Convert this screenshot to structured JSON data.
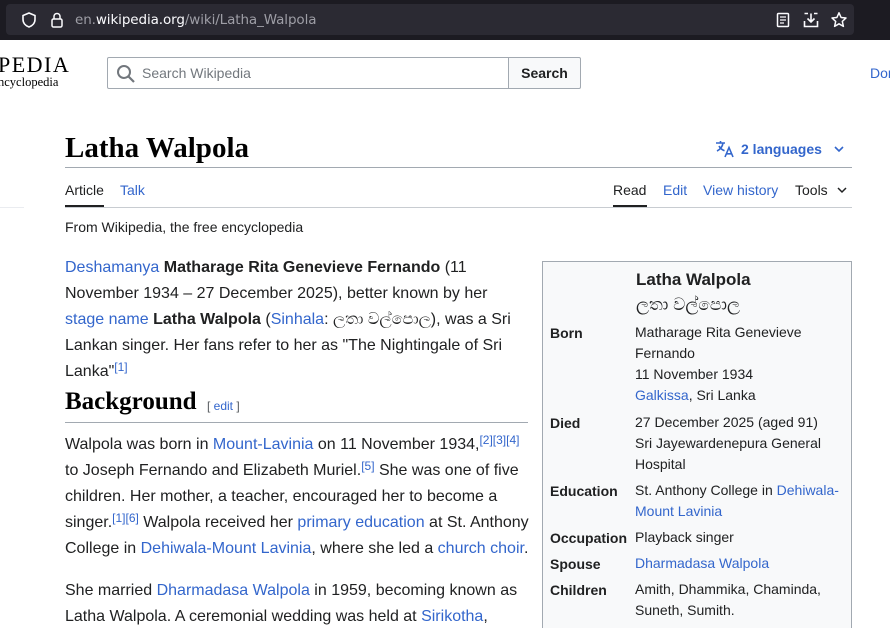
{
  "browser": {
    "url_prefix": "en.",
    "url_domain": "wikipedia.org",
    "url_path": "/wiki/Latha_Walpola",
    "icons": [
      "shield-icon",
      "lock-icon",
      "reader-view-icon",
      "save-to-pocket-icon",
      "bookmark-star-icon"
    ]
  },
  "header": {
    "logo_word": "PEDIA",
    "logo_tagline": "ncyclopedia",
    "search_placeholder": "Search Wikipedia",
    "search_button": "Search",
    "donate_link": "Donate"
  },
  "article": {
    "title": "Latha Walpola",
    "languages_label": "2 languages",
    "tabs_left": [
      "Article",
      "Talk"
    ],
    "tabs_right": [
      "Read",
      "Edit",
      "View history",
      "Tools"
    ],
    "tagline": "From Wikipedia, the free encyclopedia"
  },
  "intro": {
    "l_deshamanya": "Deshamanya",
    "t_name_full": "Matharage Rita Genevieve Fernando",
    "t_dates": " (11 November 1934 – 27 December 2025), better known by her ",
    "l_stage_name": "stage name",
    "t_sp1": " ",
    "t_name_short": "Latha Walpola",
    "t_paren_open": " (",
    "l_sinhala": "Sinhala",
    "t_native": ": ලතා වල්පොල), was a Sri Lankan singer. Her fans refer to her as \"The Nightingale of Sri Lanka\"",
    "r1": "[1]"
  },
  "background": {
    "heading": "Background",
    "edit_open": "[ ",
    "edit_label": "edit",
    "edit_close": " ]",
    "p1": {
      "t1": "Walpola was born in ",
      "l_mount_lavinia": "Mount-Lavinia",
      "t2": " on 11 November 1934,",
      "r1": "[2]",
      "r2": "[3]",
      "r3": "[4]",
      "t3": " to Joseph Fernando and Elizabeth Muriel.",
      "r4": "[5]",
      "t4": " She was one of five children. Her mother, a teacher, encouraged her to become a singer.",
      "r5": "[1]",
      "r6": "[6]",
      "t5": " Walpola received her ",
      "l_primary_education": "primary education",
      "t6": " at St. Anthony College in ",
      "l_dehiwala": "Dehiwala-Mount Lavinia",
      "t7": ", where she led a ",
      "l_church_choir": "church choir",
      "t8": "."
    },
    "p2": {
      "t1": "She married ",
      "l_dharmadasa": "Dharmadasa Walpola",
      "t2": " in 1959, becoming known as Latha Walpola. A ceremonial wedding was held at ",
      "l_sirikotha": "Sirikotha",
      "t3": ","
    }
  },
  "infobox": {
    "name": "Latha Walpola",
    "native_name": "ලතා වල්පොල",
    "born_label": "Born",
    "born_name": "Matharage Rita Genevieve Fernando",
    "born_date": "11 November 1934",
    "born_place_link": "Galkissa",
    "born_place_rest": ", Sri Lanka",
    "died_label": "Died",
    "died_date": "27 December 2025 (aged 91)",
    "died_place": "Sri Jayewardenepura General Hospital",
    "education_label": "Education",
    "education_text": "St. Anthony College in ",
    "education_link": "Dehiwala-Mount Lavinia",
    "occupation_label": "Occupation",
    "occupation_value": "Playback singer",
    "spouse_label": "Spouse",
    "spouse_link": "Dharmadasa Walpola",
    "children_label": "Children",
    "children_value": "Amith, Dhammika, Chaminda, Suneth, Sumith."
  },
  "colors": {
    "link": "#3366cc",
    "text": "#202122",
    "browser_bg": "#1c1b22",
    "url_bg": "#2b2a33",
    "infobox_bg": "#f8f9fa"
  }
}
